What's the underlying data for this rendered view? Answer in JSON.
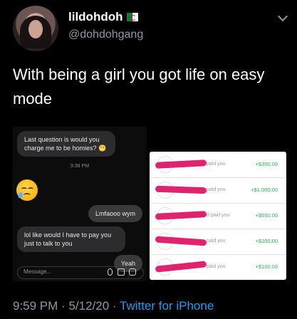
{
  "author": {
    "display_name": "lildohdoh",
    "handle": "@dohdohgang"
  },
  "tweet": {
    "text": "With being a girl you got life on easy mode",
    "time": "9:59 PM",
    "date": "5/12/20",
    "source": "Twitter for iPhone"
  },
  "chat": {
    "messages": [
      {
        "text": "Last question is would you charge me to be homies? 😬"
      },
      {
        "text": "9:38 PM"
      },
      {
        "text": "Lmfaooo wym"
      },
      {
        "text": "lol like would I have to pay you just to talk to you"
      },
      {
        "text": "Yeah"
      }
    ],
    "placeholder": "Message..."
  },
  "payments": {
    "rows": [
      {
        "paid": "paid you",
        "amount": "+$300.00"
      },
      {
        "paid": "paid you",
        "amount": "+$1,000.00"
      },
      {
        "paid": "d paid you",
        "amount": "+$650.00"
      },
      {
        "paid": "paid you",
        "amount": "+$200.00"
      },
      {
        "paid": "paid you",
        "amount": "+$100.00"
      }
    ],
    "amount_color": "#2eae5b",
    "redact_color": "#e0226f"
  },
  "icons": [
    "chevron-down-icon",
    "algeria-flag-icon",
    "microphone-icon",
    "gallery-icon",
    "sticker-icon"
  ]
}
